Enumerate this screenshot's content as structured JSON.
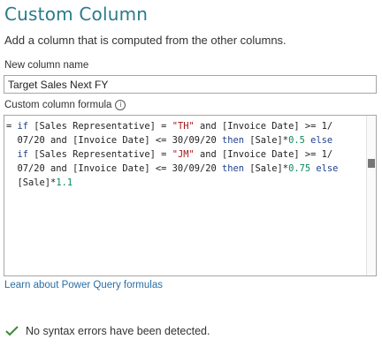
{
  "dialog": {
    "title": "Custom Column",
    "subtitle": "Add a column that is computed from the other columns."
  },
  "name_field": {
    "label": "New column name",
    "value": "Target Sales Next FY"
  },
  "formula_field": {
    "label": "Custom column formula",
    "info_icon": "info-icon",
    "lines": [
      "= if [Sales Representative] = \"TH\" and [Invoice Date] >= 1/",
      "  07/20 and [Invoice Date] <= 30/09/20 then [Sale]*0.5 else",
      "  if [Sales Representative] = \"JM\" and [Invoice Date] >= 1/",
      "  07/20 and [Invoice Date] <= 30/09/20 then [Sale]*0.75 else",
      "  [Sale]*1.1"
    ]
  },
  "learn_link": "Learn about Power Query formulas",
  "status": {
    "icon": "checkmark-icon",
    "text": "No syntax errors have been detected.",
    "color": "#3a8a3a"
  },
  "colors": {
    "title": "#2a7a8c",
    "link": "#2a6ea6",
    "keyword": "#1f3f8f",
    "string": "#a31515",
    "number": "#09885a"
  }
}
